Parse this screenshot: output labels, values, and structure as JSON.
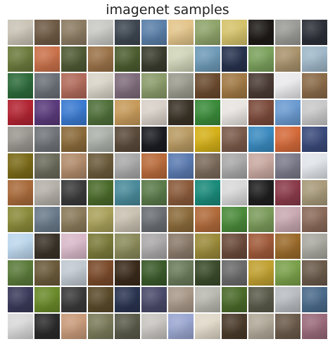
{
  "figure": {
    "title": "imagenet samples"
  },
  "grid": {
    "rows": 12,
    "cols": 12,
    "tiles": [
      [
        "#c9c3b5",
        "#6e5a44",
        "#8b7b62",
        "#c8c9c5",
        "#3d4650",
        "#5a7fa8",
        "#e2c48a",
        "#8ea36a",
        "#d4c26b",
        "#1d1a17",
        "#9a9a96",
        "#2c2f38"
      ],
      [
        "#6c7a3c",
        "#c9714a",
        "#4f5a34",
        "#9a7248",
        "#4c5d2f",
        "#3a3c2e",
        "#cfd4b8",
        "#6e9ab7",
        "#27324d",
        "#7aa05c",
        "#a8926c",
        "#9fb7c8"
      ],
      [
        "#2d6a3a",
        "#6a6f77",
        "#b06a5a",
        "#d8d3c7",
        "#7e6b7a",
        "#8a9b6a",
        "#9a9a8e",
        "#6a4a2e",
        "#a07844",
        "#4a3a34",
        "#e9e9ec",
        "#8a6a48"
      ],
      [
        "#b22432",
        "#5a3a7a",
        "#3a7ad0",
        "#4f6f3a",
        "#c69a5a",
        "#d8d0c8",
        "#3a3226",
        "#3a8a3a",
        "#e8e4e0",
        "#7a4a3a",
        "#6a9ad0",
        "#c8c8c8"
      ],
      [
        "#9a9690",
        "#707478",
        "#8a6a3a",
        "#aab0a8",
        "#5a4a3a",
        "#1a1c22",
        "#b89a62",
        "#d4b018",
        "#7a5a4a",
        "#3a8abf",
        "#d46a3a",
        "#3a4a7a"
      ],
      [
        "#7a6a18",
        "#6a6a5a",
        "#b08a6a",
        "#6a5a3a",
        "#a8a8a8",
        "#b86a3a",
        "#5a7ab0",
        "#7a6a5a",
        "#a8a8a8",
        "#c8a8a0",
        "#7a7a8a",
        "#e0e4e8"
      ],
      [
        "#a86a3a",
        "#b4b0a8",
        "#3a3a3a",
        "#4a6a2a",
        "#4a8a9a",
        "#5a7a4a",
        "#8a5a3a",
        "#1a8a7a",
        "#d8d8d8",
        "#1e1e1e",
        "#8a3a4a",
        "#a89a7a"
      ],
      [
        "#8a8a3a",
        "#6a7a8a",
        "#8a7a5a",
        "#a8a05a",
        "#c8c0b0",
        "#6a6e72",
        "#8a6a3a",
        "#b06a3a",
        "#4a8a3a",
        "#7a9a5a",
        "#c8a8b0",
        "#8a6a5a"
      ],
      [
        "#bcd6ec",
        "#3a3228",
        "#d8b8c8",
        "#7a7a3a",
        "#8a8a5a",
        "#aaa8a8",
        "#8a7a6a",
        "#9a8a3a",
        "#6a4a3a",
        "#a05a3a",
        "#9a6a2a",
        "#a8a8a0"
      ],
      [
        "#5a7a3a",
        "#6a5a3a",
        "#c0c8d0",
        "#7a4a2a",
        "#3a2a1a",
        "#3a5a2a",
        "#6a7a5a",
        "#3a4a2a",
        "#6a6a6a",
        "#c0a030",
        "#7aa04a",
        "#6a5a4a"
      ],
      [
        "#3a3a5a",
        "#6a8a2a",
        "#3a3a3a",
        "#5a4a2a",
        "#2a3450",
        "#4a4a6a",
        "#a89888",
        "#b8b8b0",
        "#4a6a2a",
        "#5a5a4a",
        "#b8bcc0",
        "#4a6a8a"
      ],
      [
        "#d8d8d8",
        "#2a2a2a",
        "#c89a7a",
        "#7a7a5a",
        "#5a5a4a",
        "#c8c4c0",
        "#9aa6d0",
        "#e0d8c8",
        "#4a3a2a",
        "#b0a898",
        "#6a5a4a",
        "#9a6a7a"
      ]
    ]
  }
}
